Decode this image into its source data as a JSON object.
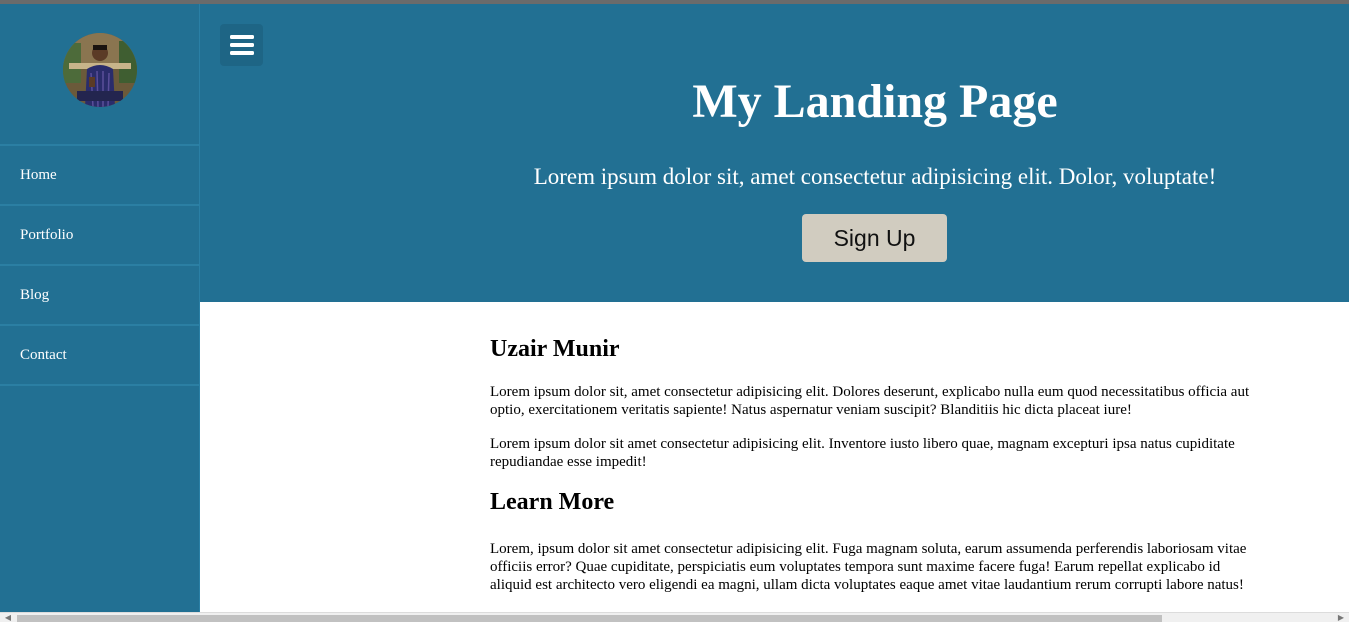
{
  "sidebar": {
    "avatar_icon": "profile-photo",
    "items": [
      {
        "label": "Home"
      },
      {
        "label": "Portfolio"
      },
      {
        "label": "Blog"
      },
      {
        "label": "Contact"
      }
    ]
  },
  "hero": {
    "menu_icon": "hamburger-icon",
    "title": "My Landing Page",
    "subtitle": "Lorem ipsum dolor sit, amet consectetur adipisicing elit. Dolor, voluptate!",
    "button_label": "Sign Up"
  },
  "content": {
    "section1": {
      "heading": "Uzair Munir",
      "paragraphs": [
        "Lorem ipsum dolor sit, amet consectetur adipisicing elit. Dolores deserunt, explicabo nulla eum quod necessitatibus officia aut optio, exercitationem veritatis sapiente! Natus aspernatur veniam suscipit? Blanditiis hic dicta placeat iure!",
        "Lorem ipsum dolor sit amet consectetur adipisicing elit. Inventore iusto libero quae, magnam excepturi ipsa natus cupiditate repudiandae esse impedit!"
      ]
    },
    "section2": {
      "heading": "Learn More",
      "paragraphs": [
        "Lorem, ipsum dolor sit amet consectetur adipisicing elit. Fuga magnam soluta, earum assumenda perferendis laboriosam vitae officiis error? Quae cupiditate, perspiciatis eum voluptates tempora sunt maxime facere fuga! Earum repellat explicabo id aliquid est architecto vero eligendi ea magni, ullam dicta voluptates eaque amet vitae laudantium rerum corrupti labore natus!"
      ]
    }
  },
  "colors": {
    "primary": "#227093",
    "button": "#d1ccc0",
    "text_light": "#ffffff"
  }
}
